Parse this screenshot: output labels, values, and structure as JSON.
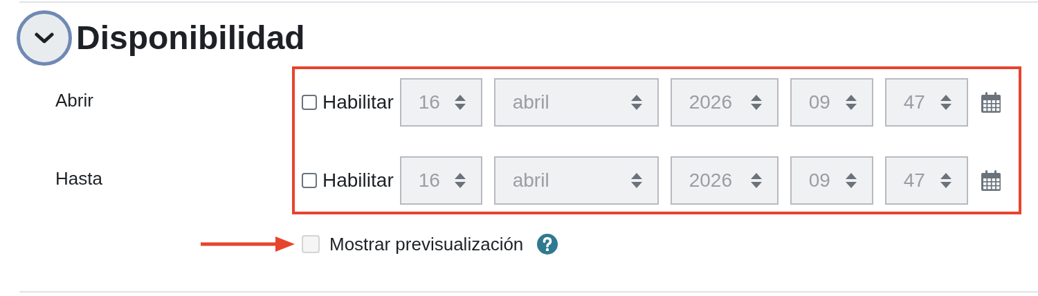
{
  "section": {
    "title": "Disponibilidad",
    "expanded": true
  },
  "rows": [
    {
      "label": "Abrir",
      "enable": {
        "label": "Habilitar",
        "checked": false
      },
      "fields": [
        {
          "kind": "day",
          "value": "16"
        },
        {
          "kind": "month",
          "value": "abril"
        },
        {
          "kind": "year",
          "value": "2026"
        },
        {
          "kind": "hour",
          "value": "09"
        },
        {
          "kind": "minute",
          "value": "47"
        }
      ]
    },
    {
      "label": "Hasta",
      "enable": {
        "label": "Habilitar",
        "checked": false
      },
      "fields": [
        {
          "kind": "day",
          "value": "16"
        },
        {
          "kind": "month",
          "value": "abril"
        },
        {
          "kind": "year",
          "value": "2026"
        },
        {
          "kind": "hour",
          "value": "09"
        },
        {
          "kind": "minute",
          "value": "47"
        }
      ]
    }
  ],
  "preview": {
    "label": "Mostrar previsualización",
    "checked": false,
    "disabled": true
  }
}
